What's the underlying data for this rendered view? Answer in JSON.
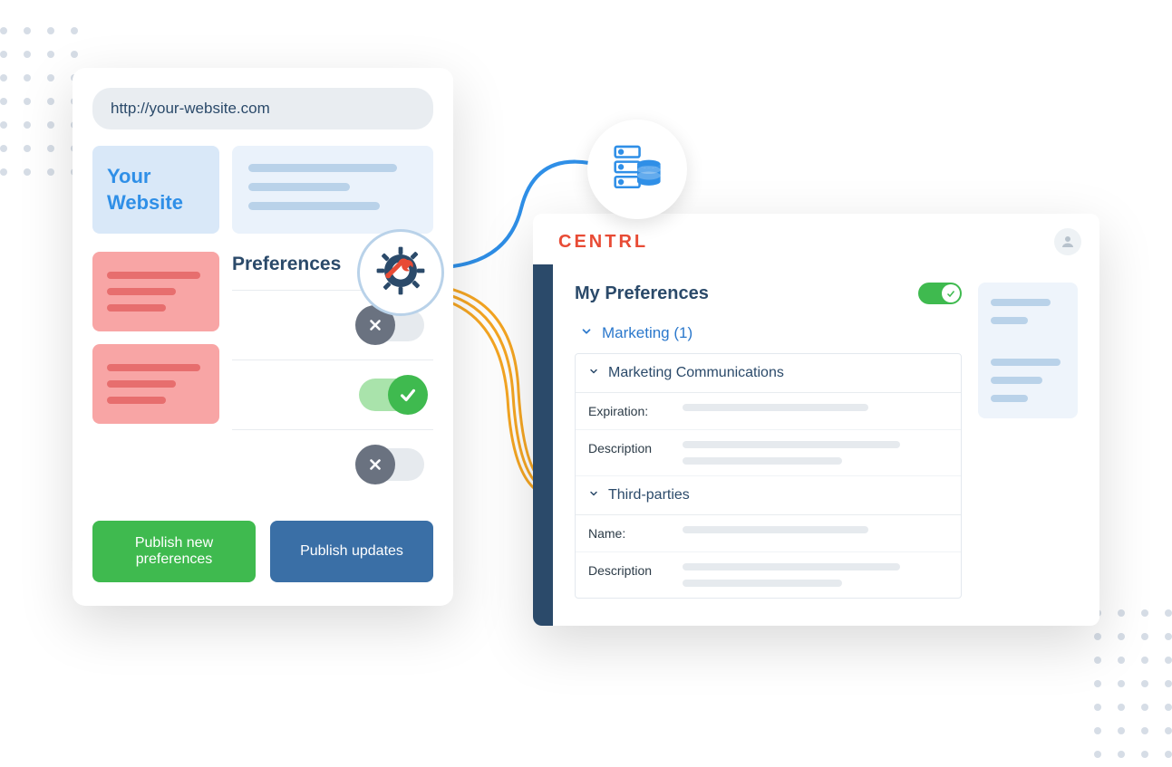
{
  "left": {
    "url": "http://your-website.com",
    "title_line1": "Your",
    "title_line2": "Website",
    "preferences_label": "Preferences",
    "toggles": [
      {
        "state": "off"
      },
      {
        "state": "on"
      },
      {
        "state": "off"
      }
    ],
    "buttons": {
      "publish_new": "Publish new preferences",
      "publish_updates": "Publish updates"
    }
  },
  "right": {
    "brand": "CENTRL",
    "title": "My Preferences",
    "toggle_state": "on",
    "section": {
      "label": "Marketing (1)"
    },
    "group1": {
      "header": "Marketing Communications",
      "rows": [
        {
          "label": "Expiration:"
        },
        {
          "label": "Description"
        }
      ]
    },
    "group2": {
      "header": "Third-parties",
      "rows": [
        {
          "label": "Name:"
        },
        {
          "label": "Description"
        }
      ]
    }
  },
  "icons": {
    "gear": "gear-wrench-icon",
    "db": "database-server-icon",
    "avatar": "user-avatar-icon"
  },
  "colors": {
    "accent_blue": "#2f8fe7",
    "accent_green": "#3fba4f",
    "accent_red": "#e84b35",
    "navy": "#2b4a6a",
    "pink": "#f8a5a5"
  }
}
